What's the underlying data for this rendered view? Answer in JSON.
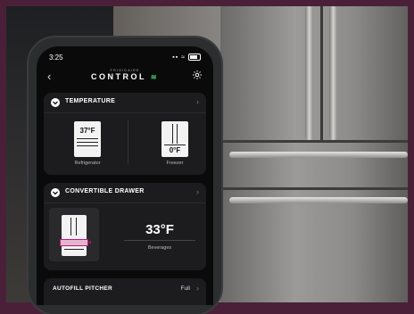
{
  "status": {
    "time": "3:25"
  },
  "header": {
    "brand_sub": "FRIGIDAIRE",
    "brand": "CONTROL",
    "back_icon": "chevron-left-icon",
    "settings_icon": "gear-icon"
  },
  "temperature": {
    "title": "TEMPERATURE",
    "refrigerator": {
      "value": "37°F",
      "label": "Refrigerator"
    },
    "freezer": {
      "value": "0°F",
      "label": "Freezer"
    }
  },
  "drawer": {
    "title": "CONVERTIBLE DRAWER",
    "value": "33°F",
    "label": "Beverages",
    "accent": "#c2187a"
  },
  "autofill": {
    "title": "AUTOFILL PITCHER",
    "value": "Full"
  }
}
